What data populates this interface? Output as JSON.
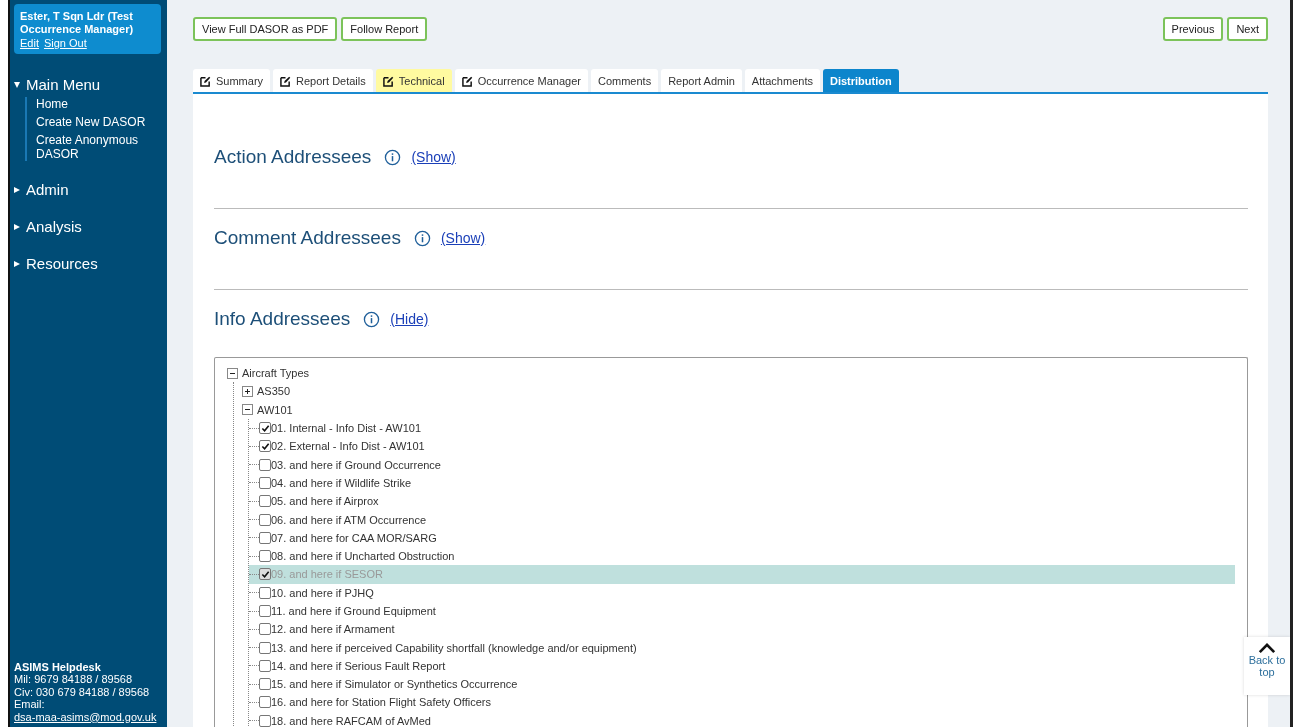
{
  "user": {
    "name": "Ester, T Sqn Ldr (Test Occurrence Manager)",
    "links": [
      "Edit",
      "Sign Out"
    ]
  },
  "menu": [
    {
      "label": "Main Menu",
      "expanded": true,
      "items": [
        "Home",
        "Create New DASOR",
        "Create Anonymous DASOR"
      ]
    },
    {
      "label": "Admin",
      "expanded": false
    },
    {
      "label": "Analysis",
      "expanded": false
    },
    {
      "label": "Resources",
      "expanded": false
    }
  ],
  "helpdesk": {
    "title": "ASIMS Helpdesk",
    "lines": [
      "Mil: 9679 84188 / 89568",
      "Civ: 030 679 84188 / 89568"
    ],
    "email_label": "Email:",
    "email": "dsa-maa-asims@mod.gov.uk"
  },
  "toolbar": {
    "left": [
      "View Full DASOR as PDF",
      "Follow Report"
    ],
    "right": [
      "Previous",
      "Next"
    ]
  },
  "tabs": [
    {
      "label": "Summary",
      "kind": "edit",
      "highlighted": false,
      "selected": false
    },
    {
      "label": "Report Details",
      "kind": "edit",
      "highlighted": false,
      "selected": false
    },
    {
      "label": "Technical",
      "kind": "edit",
      "highlighted": true,
      "selected": false
    },
    {
      "label": "Occurrence Manager",
      "kind": "edit",
      "highlighted": false,
      "selected": false
    },
    {
      "label": "Comments",
      "kind": "plain",
      "highlighted": false,
      "selected": false
    },
    {
      "label": "Report Admin",
      "kind": "plain",
      "highlighted": false,
      "selected": false
    },
    {
      "label": "Attachments",
      "kind": "plain",
      "highlighted": false,
      "selected": false
    },
    {
      "label": "Distribution",
      "kind": "plain",
      "highlighted": false,
      "selected": true
    }
  ],
  "sections": [
    {
      "title": "Action Addressees",
      "toggle": "(Show)"
    },
    {
      "title": "Comment Addressees",
      "toggle": "(Show)"
    },
    {
      "title": "Info Addressees",
      "toggle": "(Hide)",
      "tree": [
        {
          "label": "Aircraft Types",
          "kind": "group",
          "expanded": true,
          "children": [
            {
              "label": "AS350",
              "kind": "group",
              "expanded": false
            },
            {
              "label": "AW101",
              "kind": "group",
              "expanded": true,
              "children": [
                {
                  "label": "01. Internal - Info Dist - AW101",
                  "kind": "option",
                  "checked": true,
                  "selected": false,
                  "disabled": false
                },
                {
                  "label": "02. External - Info Dist - AW101",
                  "kind": "option",
                  "checked": true,
                  "selected": false,
                  "disabled": false
                },
                {
                  "label": "03. and here if Ground Occurrence",
                  "kind": "option",
                  "checked": false,
                  "selected": false,
                  "disabled": false
                },
                {
                  "label": "04. and here if Wildlife Strike",
                  "kind": "option",
                  "checked": false,
                  "selected": false,
                  "disabled": false
                },
                {
                  "label": "05. and here if Airprox",
                  "kind": "option",
                  "checked": false,
                  "selected": false,
                  "disabled": false
                },
                {
                  "label": "06. and here if ATM Occurrence",
                  "kind": "option",
                  "checked": false,
                  "selected": false,
                  "disabled": false
                },
                {
                  "label": "07. and here for CAA MOR/SARG",
                  "kind": "option",
                  "checked": false,
                  "selected": false,
                  "disabled": false
                },
                {
                  "label": "08. and here if Uncharted Obstruction",
                  "kind": "option",
                  "checked": false,
                  "selected": false,
                  "disabled": false
                },
                {
                  "label": "09. and here if SESOR",
                  "kind": "option",
                  "checked": true,
                  "selected": true,
                  "disabled": true
                },
                {
                  "label": "10. and here if PJHQ",
                  "kind": "option",
                  "checked": false,
                  "selected": false,
                  "disabled": false
                },
                {
                  "label": "11. and here if Ground Equipment",
                  "kind": "option",
                  "checked": false,
                  "selected": false,
                  "disabled": false
                },
                {
                  "label": "12. and here if Armament",
                  "kind": "option",
                  "checked": false,
                  "selected": false,
                  "disabled": false
                },
                {
                  "label": "13. and here if perceived Capability shortfall (knowledge and/or equipment)",
                  "kind": "option",
                  "checked": false,
                  "selected": false,
                  "disabled": false
                },
                {
                  "label": "14. and here if Serious Fault Report",
                  "kind": "option",
                  "checked": false,
                  "selected": false,
                  "disabled": false
                },
                {
                  "label": "15. and here if Simulator or Synthetics Occurrence",
                  "kind": "option",
                  "checked": false,
                  "selected": false,
                  "disabled": false
                },
                {
                  "label": "16. and here for Station Flight Safety Officers",
                  "kind": "option",
                  "checked": false,
                  "selected": false,
                  "disabled": false
                },
                {
                  "label": "18. and here RAFCAM of AvMed",
                  "kind": "option",
                  "checked": false,
                  "selected": false,
                  "disabled": false
                }
              ]
            }
          ]
        }
      ]
    }
  ],
  "back_to_top": "Back to top"
}
